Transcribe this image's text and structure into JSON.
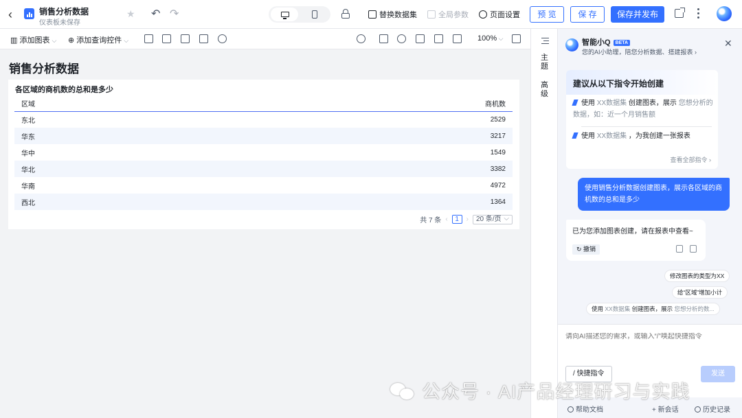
{
  "header": {
    "title": "销售分析数据",
    "subtitle": "仪表板未保存",
    "replace_dataset": "替换数据集",
    "global_params": "全局参数",
    "page_settings": "页面设置",
    "preview": "预 览",
    "save": "保 存",
    "save_publish": "保存并发布"
  },
  "toolbar": {
    "add_chart": "添加图表",
    "add_query_control": "添加查询控件",
    "zoom": "100%"
  },
  "canvas": {
    "page_title": "销售分析数据",
    "card_title": "各区域的商机数的总和是多少",
    "columns": [
      "区域",
      "商机数"
    ],
    "rows": [
      [
        "东北",
        "2529"
      ],
      [
        "华东",
        "3217"
      ],
      [
        "华中",
        "1549"
      ],
      [
        "华北",
        "3382"
      ],
      [
        "华南",
        "4972"
      ],
      [
        "西北",
        "1364"
      ]
    ],
    "pager": {
      "total": "共 7 条",
      "current_page": "1",
      "page_size": "20 条/页"
    }
  },
  "side_tabs": {
    "theme": "主题",
    "advanced": "高级"
  },
  "assistant": {
    "name": "智能小Q",
    "badge": "BETA",
    "tagline": "您的AI小助理，陪您分析数据、搭建报表",
    "suggest_title": "建议从以下指令开始创建",
    "suggest_1_a": "使用 ",
    "suggest_1_b": "XX数据集",
    "suggest_1_c": " 创建图表，展示 ",
    "suggest_1_d": "您想分析的数据",
    "suggest_1_e": "，如：近一个月销售额",
    "suggest_2_a": "使用 ",
    "suggest_2_b": "XX数据集",
    "suggest_2_c": " ，为我创建一张报表",
    "view_all": "查看全部指令",
    "user_message": "使用销售分析数据创建图表，展示各区域的商机数的总和是多少",
    "ai_reply": "已为您添加图表创建，请在报表中查看~",
    "undo": "撤销",
    "chip_1": "修改图表的类型为XX",
    "chip_2": "给“区域”增加小计",
    "chip_3_a": "使用 ",
    "chip_3_b": "XX数据集",
    "chip_3_c": " 创建图表，展示 ",
    "chip_3_d": "您想分析的数...",
    "input_placeholder": "请向AI描述您的需求，或输入“/”唤起快捷指令",
    "quick_cmd": "快捷指令",
    "send": "发送",
    "help_docs": "帮助文档",
    "new_chat": "新会话",
    "history": "历史记录"
  },
  "watermark_text": "公众号 · AI产品经理研习与实践",
  "colors": {
    "accent": "#3370ff",
    "table_stripe": "#f2f6fd",
    "panel_bg": "#f3f5fa"
  }
}
